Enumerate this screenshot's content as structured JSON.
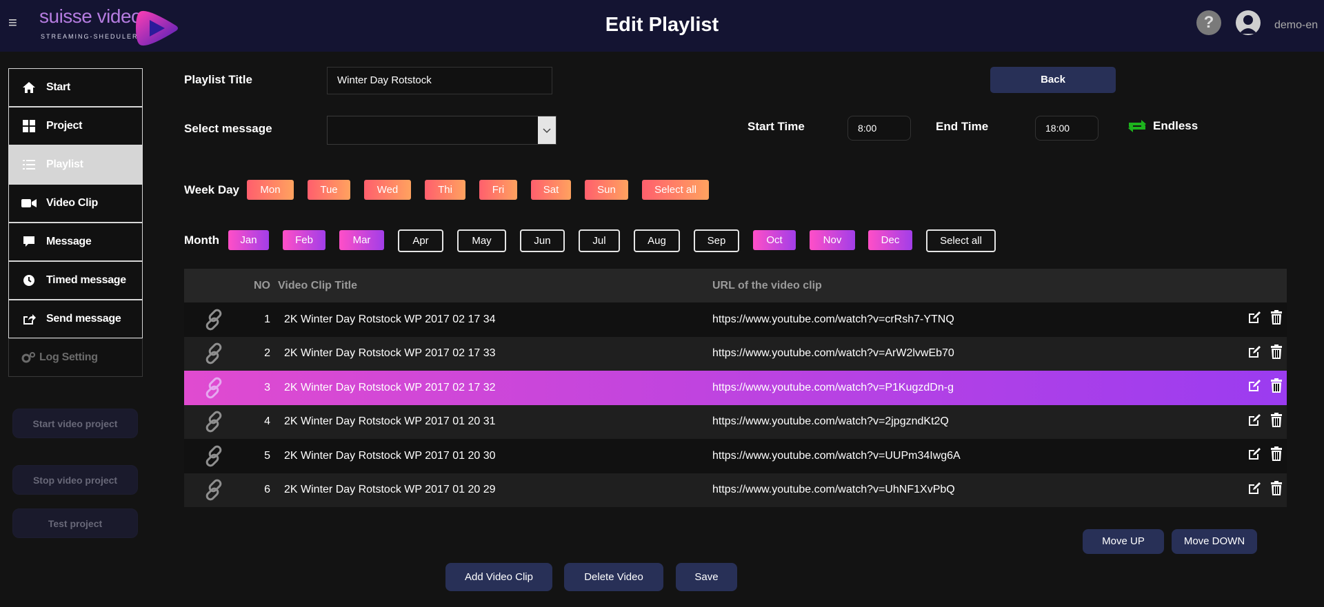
{
  "header": {
    "menu_glyph": "≡",
    "logo_text": "suisse video",
    "logo_sub": "STREAMING-SHEDULER",
    "title": "Edit Playlist",
    "help_glyph": "?",
    "username": "demo-en"
  },
  "sidebar": {
    "items": [
      {
        "label": "Start",
        "icon": "home-icon"
      },
      {
        "label": "Project",
        "icon": "grid-icon"
      },
      {
        "label": "Playlist",
        "icon": "list-icon"
      },
      {
        "label": "Video Clip",
        "icon": "video-camera-icon"
      },
      {
        "label": "Message",
        "icon": "message-icon"
      },
      {
        "label": "Timed message",
        "icon": "clock-icon"
      },
      {
        "label": "Send message",
        "icon": "share-icon"
      },
      {
        "label": "Log Setting",
        "icon": "gears-icon"
      }
    ],
    "active_index": 2,
    "buttons": {
      "start": "Start video project",
      "stop": "Stop video project",
      "test": "Test project"
    }
  },
  "form": {
    "playlist_title_label": "Playlist Title",
    "playlist_title_value": "Winter Day Rotstock",
    "select_message_label": "Select message",
    "select_message_value": "",
    "back_label": "Back",
    "start_time_label": "Start Time",
    "start_time_value": "8:00",
    "end_time_label": "End Time",
    "end_time_value": "18:00",
    "endless_label": "Endless",
    "endless_color": "#1db31d"
  },
  "weekdays": {
    "label": "Week Day",
    "days": [
      "Mon",
      "Tue",
      "Wed",
      "Thi",
      "Fri",
      "Sat",
      "Sun"
    ],
    "select_all": "Select all"
  },
  "months": {
    "label": "Month",
    "list": [
      {
        "name": "Jan",
        "selected": true
      },
      {
        "name": "Feb",
        "selected": true
      },
      {
        "name": "Mar",
        "selected": true
      },
      {
        "name": "Apr",
        "selected": false
      },
      {
        "name": "May",
        "selected": false
      },
      {
        "name": "Jun",
        "selected": false
      },
      {
        "name": "Jul",
        "selected": false
      },
      {
        "name": "Aug",
        "selected": false
      },
      {
        "name": "Sep",
        "selected": false
      },
      {
        "name": "Oct",
        "selected": true
      },
      {
        "name": "Nov",
        "selected": true
      },
      {
        "name": "Dec",
        "selected": true
      }
    ],
    "select_all": "Select all"
  },
  "table": {
    "headers": {
      "no": "NO",
      "title": "Video Clip Title",
      "url": "URL of the video clip"
    },
    "rows": [
      {
        "no": "1",
        "title": "2K Winter Day Rotstock WP 2017 02 17 34",
        "url": "https://www.youtube.com/watch?v=crRsh7-YTNQ"
      },
      {
        "no": "2",
        "title": "2K Winter Day Rotstock WP 2017 02 17 33",
        "url": "https://www.youtube.com/watch?v=ArW2lvwEb70"
      },
      {
        "no": "3",
        "title": "2K Winter Day Rotstock WP 2017 02 17 32",
        "url": "https://www.youtube.com/watch?v=P1KugzdDn-g"
      },
      {
        "no": "4",
        "title": "2K Winter Day Rotstock WP 2017 01 20 31",
        "url": "https://www.youtube.com/watch?v=2jpgzndKt2Q"
      },
      {
        "no": "5",
        "title": "2K Winter Day Rotstock WP 2017 01 20 30",
        "url": "https://www.youtube.com/watch?v=UUPm34Iwg6A"
      },
      {
        "no": "6",
        "title": "2K Winter Day Rotstock WP 2017 01 20 29",
        "url": "https://www.youtube.com/watch?v=UhNF1XvPbQ"
      }
    ],
    "selected_index": 2
  },
  "actions": {
    "move_up": "Move UP",
    "move_down": "Move DOWN",
    "add_clip": "Add Video Clip",
    "delete_video": "Delete Video",
    "save": "Save"
  },
  "colors": {
    "accent_button": "#283057",
    "weekday_gradient": [
      "#ff5f6d",
      "#ffa25f"
    ],
    "month_gradient": [
      "#ff4fc7",
      "#a23ee8"
    ],
    "selected_row_gradient": [
      "#e04bd0",
      "#9b3cf0"
    ]
  }
}
